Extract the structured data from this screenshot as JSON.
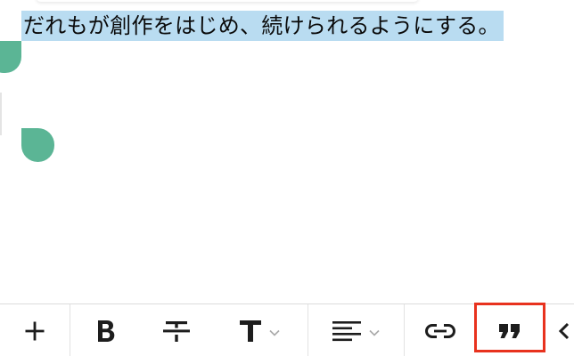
{
  "editor": {
    "selected_text": "だれもが創作をはじめ、続けられるようにする。"
  },
  "toolbar": {
    "items": [
      {
        "name": "add",
        "icon": "plus-icon"
      },
      {
        "name": "bold",
        "icon": "bold-icon"
      },
      {
        "name": "strikethrough",
        "icon": "strikethrough-icon"
      },
      {
        "name": "text-style",
        "icon": "heading-t-icon",
        "dropdown": true
      },
      {
        "name": "align",
        "icon": "align-left-icon",
        "dropdown": true
      },
      {
        "name": "link",
        "icon": "link-icon"
      },
      {
        "name": "quote",
        "icon": "quote-icon",
        "highlighted": true
      }
    ]
  },
  "colors": {
    "selection_bg": "#b9dcf1",
    "handle": "#5bb595",
    "highlight_border": "#e8321e",
    "icon": "#1d1d1d"
  }
}
